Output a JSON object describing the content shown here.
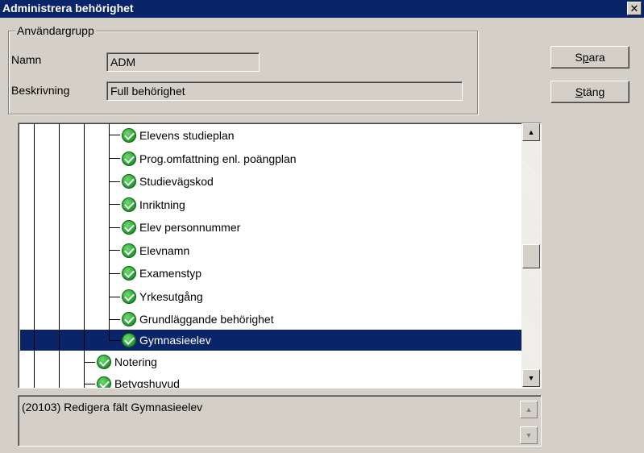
{
  "window": {
    "title": "Administrera behörighet",
    "close_glyph": "✕"
  },
  "group": {
    "legend": "Användargrupp",
    "name_label": "Namn",
    "name_value": "ADM",
    "desc_label": "Beskrivning",
    "desc_value": "Full behörighet"
  },
  "buttons": {
    "save_pre": "S",
    "save_accel": "p",
    "save_post": "ara",
    "close_pre": "",
    "close_accel": "S",
    "close_post": "täng"
  },
  "tree": {
    "items": [
      {
        "label": "Elevens studieplan",
        "icon": "green-check-icon"
      },
      {
        "label": "Prog.omfattning enl. poängplan",
        "icon": "green-check-icon"
      },
      {
        "label": "Studievägskod",
        "icon": "green-check-icon"
      },
      {
        "label": "Inriktning",
        "icon": "green-check-icon"
      },
      {
        "label": "Elev personnummer",
        "icon": "green-check-icon"
      },
      {
        "label": "Elevnamn",
        "icon": "green-check-icon"
      },
      {
        "label": "Examenstyp",
        "icon": "green-check-icon"
      },
      {
        "label": "Yrkesutgång",
        "icon": "green-check-icon"
      },
      {
        "label": "Grundläggande behörighet",
        "icon": "green-check-icon"
      },
      {
        "label": "Gymnasieelev",
        "icon": "green-check-icon",
        "selected": true
      },
      {
        "label": "Notering",
        "icon": "green-check-icon"
      },
      {
        "label": "Betygshuvud",
        "icon": "green-check-icon"
      }
    ],
    "scroll_up_glyph": "▲",
    "scroll_down_glyph": "▼"
  },
  "description": {
    "text": "(20103) Redigera fält Gymnasieelev",
    "scroll_up_glyph": "▲",
    "scroll_down_glyph": "▼"
  },
  "colors": {
    "title_bg": "#0a246a",
    "selection_bg": "#0a246a",
    "dialog_bg": "#d4d0c8",
    "check_green": "#1f9a2a"
  }
}
